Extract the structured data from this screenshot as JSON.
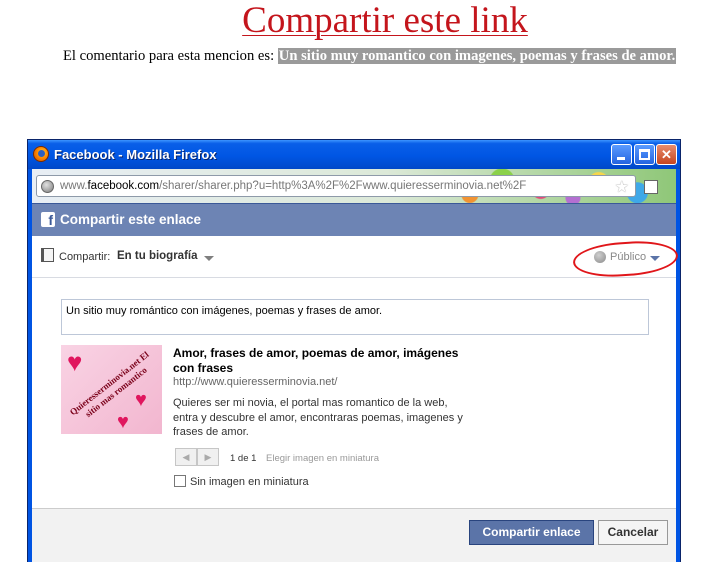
{
  "page": {
    "title": "Compartir este link",
    "mention_prefix": "El comentario para esta mencion es:",
    "mention_text": "Un sitio muy romantico con imagenes, poemas y frases de amor."
  },
  "window": {
    "title": "Facebook - Mozilla Firefox",
    "url_scheme": "www.",
    "url_host": "facebook.com",
    "url_path": "/sharer/sharer.php?u=http%3A%2F%2Fwww.quieresserminovia.net%2F"
  },
  "dialog": {
    "header_title": "Compartir este enlace",
    "share_label": "Compartir:",
    "share_target": "En tu biografía",
    "audience": "Público",
    "comment_value": "Un sitio muy romántico con imágenes, poemas y frases de amor.",
    "thumbnail_text": "Quieresserminovia.net El sitio mas romantico",
    "link_title": "Amor, frases de amor, poemas de amor, imágenes con frases",
    "link_url": "http://www.quieresserminovia.net/",
    "link_description": "Quieres ser mi novia, el portal mas romantico de la web, entra y descubre el amor, encontraras poemas, imagenes y frases de amor.",
    "page_count": "1 de 1",
    "choose_thumbnail": "Elegir imagen en miniatura",
    "no_thumbnail_label": "Sin imagen en miniatura",
    "share_button": "Compartir enlace",
    "cancel_button": "Cancelar"
  },
  "colors": {
    "title_red": "#c4151c",
    "fb_header": "#6d84b4",
    "fb_button": "#5b74a8",
    "xp_titlebar": "#0054e3",
    "annotation_red": "#e0161a"
  }
}
